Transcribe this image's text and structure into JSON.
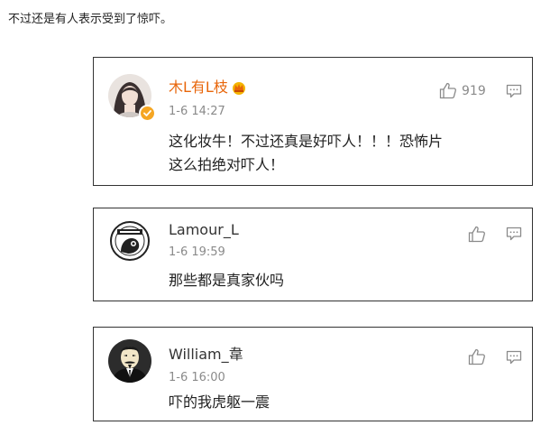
{
  "caption": "不过还是有人表示受到了惊吓。",
  "comments": [
    {
      "username": "木L有L枝",
      "time": "1-6 14:27",
      "text_lines": [
        "这化妆牛！不过还真是好吓人！！！恐怖片",
        "这么拍绝对吓人！"
      ],
      "likes": "919",
      "verified": true,
      "username_color": "#e8660b",
      "avatar_icon": "girl-avatar",
      "badge_icon": "crown-badge-icon"
    },
    {
      "username": "Lamour_L",
      "time": "1-6 19:59",
      "text_lines": [
        "那些都是真家伙吗"
      ],
      "likes": "",
      "verified": false,
      "avatar_icon": "round-logo-avatar"
    },
    {
      "username": "William_韋",
      "time": "1-6 16:00",
      "text_lines": [
        "吓的我虎躯一震"
      ],
      "likes": "",
      "verified": false,
      "avatar_icon": "mask-avatar"
    }
  ],
  "icons": {
    "like": "thumbs-up-icon",
    "reply": "comment-icon",
    "verified": "verified-badge-icon"
  }
}
